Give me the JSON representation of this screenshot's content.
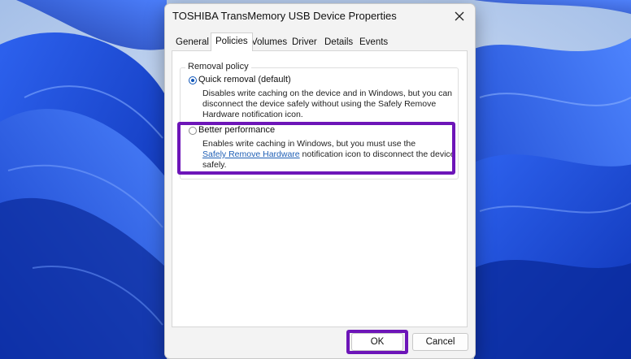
{
  "window": {
    "title": "TOSHIBA TransMemory USB Device Properties"
  },
  "tabs": [
    {
      "label": "General"
    },
    {
      "label": "Policies"
    },
    {
      "label": "Volumes"
    },
    {
      "label": "Driver"
    },
    {
      "label": "Details"
    },
    {
      "label": "Events"
    }
  ],
  "active_tab": "Policies",
  "removal_policy": {
    "group_label": "Removal policy",
    "options": [
      {
        "label": "Quick removal (default)",
        "checked": true,
        "description_lines": [
          "Disables write caching on the device and in Windows, but you can",
          "disconnect the device safely without using the Safely Remove",
          "Hardware notification icon."
        ]
      },
      {
        "label": "Better performance",
        "checked": false,
        "description_line1": "Enables write caching in Windows, but you must use the",
        "link_text": "Safely Remove Hardware",
        "description_line2_rest": " notification icon to disconnect the device",
        "description_line3": "safely."
      }
    ]
  },
  "buttons": {
    "ok": "OK",
    "cancel": "Cancel"
  },
  "colors": {
    "highlight": "#6d15b8",
    "link": "#1f5fb5",
    "radio_checked": "#0f55b8"
  }
}
